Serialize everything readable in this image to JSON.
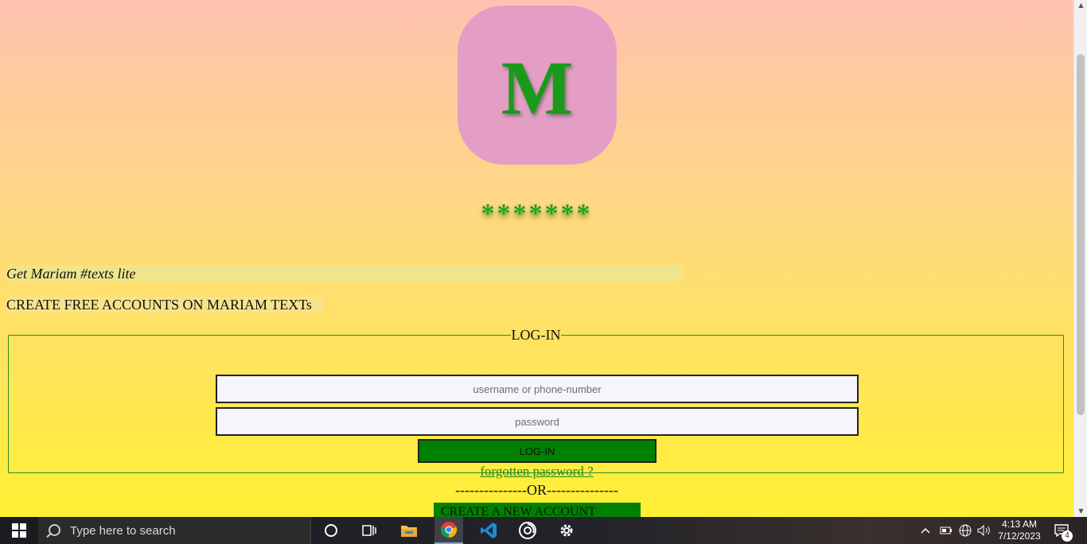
{
  "logo": {
    "letter": "M",
    "background": "#e49ec6",
    "letter_color": "#1a9a1a"
  },
  "stars": "*******",
  "tagline": "Get Mariam #texts lite",
  "create_free_text": "CREATE FREE ACCOUNTS ON MARIAM TEXTs",
  "login": {
    "legend": "LOG-IN",
    "username_placeholder": "username or phone-number",
    "password_placeholder": "password",
    "button_label": "LOG-IN",
    "forgot_label": "forgotten password ?"
  },
  "or_divider": "---------------OR---------------",
  "create_account_label": "CREATE A NEW ACCOUNT",
  "colors": {
    "accent_green": "#008000",
    "gradient_top": "#ffc2b0",
    "gradient_bottom": "#fff033"
  },
  "taskbar": {
    "search_placeholder": "Type here to search",
    "apps": [
      "cortana-icon",
      "task-view-icon",
      "file-explorer-icon",
      "chrome-icon",
      "vscode-icon",
      "obs-icon",
      "settings-icon"
    ],
    "time": "4:13 AM",
    "date": "7/12/2023",
    "notification_count": "4"
  }
}
